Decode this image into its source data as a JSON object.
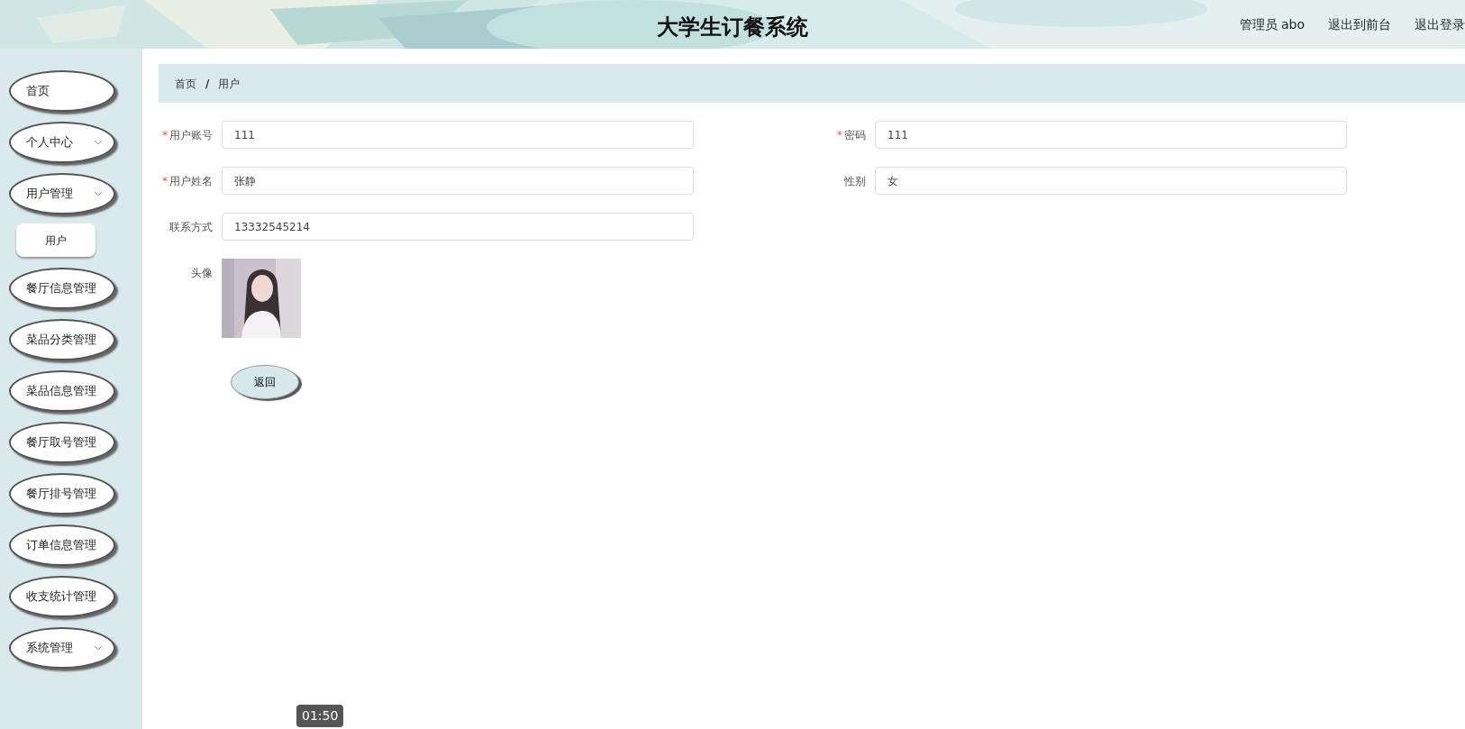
{
  "header": {
    "title": "大学生订餐系统",
    "user": "管理员 abo",
    "links": [
      "退出到前台",
      "退出登录"
    ]
  },
  "sidebar": {
    "items": [
      {
        "label": "首页",
        "kind": "link"
      },
      {
        "label": "个人中心",
        "kind": "menu"
      },
      {
        "label": "用户管理",
        "kind": "menu",
        "children": [
          {
            "label": "用户",
            "selected": true
          }
        ]
      },
      {
        "label": "餐厅信息管理",
        "kind": "link"
      },
      {
        "label": "菜品分类管理",
        "kind": "link"
      },
      {
        "label": "菜品信息管理",
        "kind": "link"
      },
      {
        "label": "餐厅取号管理",
        "kind": "link"
      },
      {
        "label": "餐厅排号管理",
        "kind": "link"
      },
      {
        "label": "订单信息管理",
        "kind": "link"
      },
      {
        "label": "收支统计管理",
        "kind": "link"
      },
      {
        "label": "系统管理",
        "kind": "menu"
      }
    ]
  },
  "breadcrumb": {
    "items": [
      "首页",
      "用户"
    ],
    "separator": "/"
  },
  "form": {
    "rows": [
      [
        {
          "label": "用户账号",
          "value": "111",
          "required": true
        },
        {
          "label": "密码",
          "value": "111",
          "required": true
        }
      ],
      [
        {
          "label": "用户姓名",
          "value": "张静",
          "required": true
        },
        {
          "label": "性别",
          "value": "女",
          "required": false
        }
      ],
      [
        {
          "label": "联系方式",
          "value": "13332545214",
          "required": false
        }
      ],
      [
        {
          "label": "头像",
          "kind": "picture",
          "required": false
        }
      ]
    ],
    "required_mark": "*",
    "button": "返回"
  },
  "video_overlay": {
    "timestamp": "01:50"
  }
}
